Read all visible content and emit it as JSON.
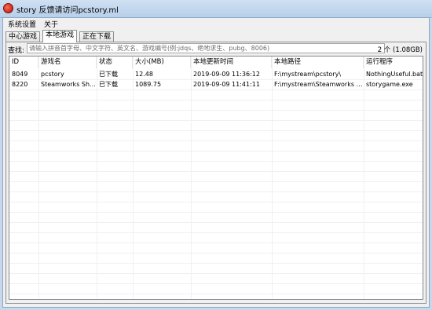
{
  "window": {
    "title": "story 反馈请访问pcstory.ml"
  },
  "menu": [
    "系统设置",
    "关于"
  ],
  "tabs": [
    {
      "label": "中心游戏",
      "active": false
    },
    {
      "label": "本地游戏",
      "active": true
    },
    {
      "label": "正在下载",
      "active": false
    }
  ],
  "search": {
    "label": "查找:",
    "placeholder": "请输入拼音首字母、中文字符、英文名、游戏编号(例:jdqs、绝地求生、pubg、8006)",
    "value": ""
  },
  "summary": "2 个 (1.08GB)",
  "table": {
    "columns": [
      "ID",
      "游戏名",
      "状态",
      "大小(MB)",
      "本地更新时间",
      "本地路径",
      "运行程序"
    ],
    "rows": [
      [
        "8049",
        "pcstory",
        "已下载",
        "12.48",
        "2019-09-09 11:36:12",
        "F:\\mystream\\pcstory\\",
        "NothingUseful.bat"
      ],
      [
        "8220",
        "Steamworks Sh...",
        "已下载",
        "1089.75",
        "2019-09-09 11:41:11",
        "F:\\mystream\\Steamworks S...",
        "storygame.exe"
      ]
    ]
  }
}
